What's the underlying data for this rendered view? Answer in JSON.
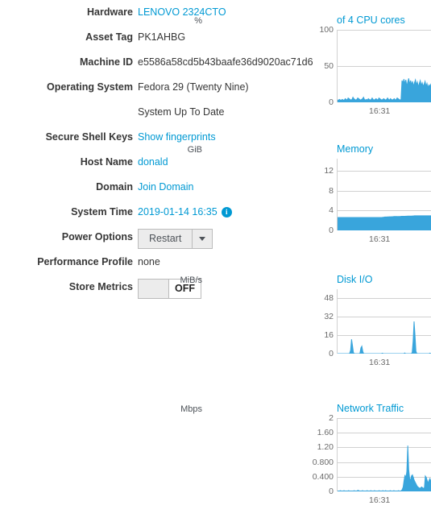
{
  "system_info": {
    "rows": [
      {
        "label": "Hardware",
        "value": "LENOVO 2324CTO",
        "type": "link"
      },
      {
        "label": "Asset Tag",
        "value": "PK1AHBG",
        "type": "text"
      },
      {
        "label": "Machine ID",
        "value": "e5586a58cd5b43baafe36d9020ac71d6",
        "type": "text"
      },
      {
        "label": "Operating System",
        "value": "Fedora 29 (Twenty Nine)",
        "type": "text"
      },
      {
        "label": "",
        "value": "System Up To Date",
        "type": "text"
      },
      {
        "label": "Secure Shell Keys",
        "value": "Show fingerprints",
        "type": "link"
      },
      {
        "label": "Host Name",
        "value": "donald",
        "type": "link"
      },
      {
        "label": "Domain",
        "value": "Join Domain",
        "type": "link"
      },
      {
        "label": "System Time",
        "value": "2019-01-14 16:35",
        "type": "link-info"
      },
      {
        "label": "Power Options",
        "value": "Restart",
        "type": "button-dropdown"
      },
      {
        "label": "Performance Profile",
        "value": "none",
        "type": "text"
      },
      {
        "label": "Store Metrics",
        "value": "OFF",
        "type": "toggle"
      }
    ],
    "info_icon_glyph": "i",
    "link_color": "#0099d3"
  },
  "chart_data": [
    {
      "type": "area",
      "title": "of 4 CPU cores",
      "unit": "%",
      "ylabel": "%",
      "xlabel": "",
      "ylim": [
        0,
        100
      ],
      "yticks": [
        100,
        50,
        0
      ],
      "ytick_labels": [
        "100",
        "50",
        "0"
      ],
      "xticks": [
        "16:31"
      ],
      "grid": true,
      "series_color": "#39a5dc",
      "values": [
        3,
        3,
        4,
        3,
        3,
        4,
        3,
        3,
        5,
        4,
        3,
        6,
        5,
        4,
        3,
        4,
        7,
        5,
        4,
        3,
        4,
        6,
        5,
        4,
        3,
        4,
        5,
        7,
        4,
        3,
        4,
        3,
        5,
        4,
        3,
        4,
        6,
        4,
        3,
        4,
        5,
        4,
        3,
        6,
        5,
        4,
        3,
        4,
        5,
        4,
        3,
        4,
        6,
        4,
        3,
        5,
        4,
        3,
        4,
        5,
        3,
        4,
        6,
        5,
        4,
        3,
        4,
        30,
        27,
        32,
        26,
        31,
        22,
        28,
        33,
        25,
        30,
        24,
        29,
        22,
        27,
        31,
        24,
        28,
        21,
        26,
        30,
        23,
        27,
        22,
        25,
        29,
        22,
        26,
        20,
        24,
        22,
        25,
        23
      ]
    },
    {
      "type": "area",
      "title": "Memory",
      "unit": "GiB",
      "ylabel": "GiB",
      "xlabel": "",
      "ylim": [
        0,
        14.5
      ],
      "yticks": [
        12,
        8,
        4,
        0
      ],
      "ytick_labels": [
        "12",
        "8",
        "4",
        "0"
      ],
      "xticks": [
        "16:31"
      ],
      "grid": true,
      "series_color": "#39a5dc",
      "values": [
        2.6,
        2.6,
        2.6,
        2.6,
        2.6,
        2.6,
        2.6,
        2.6,
        2.6,
        2.6,
        2.6,
        2.6,
        2.6,
        2.6,
        2.6,
        2.6,
        2.6,
        2.6,
        2.6,
        2.6,
        2.6,
        2.6,
        2.6,
        2.6,
        2.6,
        2.6,
        2.6,
        2.6,
        2.6,
        2.6,
        2.6,
        2.6,
        2.6,
        2.6,
        2.6,
        2.6,
        2.6,
        2.6,
        2.6,
        2.6,
        2.6,
        2.6,
        2.6,
        2.6,
        2.6,
        2.6,
        2.6,
        2.6,
        2.6,
        2.65,
        2.65,
        2.7,
        2.7,
        2.7,
        2.72,
        2.72,
        2.75,
        2.75,
        2.75,
        2.78,
        2.78,
        2.8,
        2.8,
        2.8,
        2.8,
        2.8,
        2.82,
        2.82,
        2.82,
        2.85,
        2.85,
        2.85,
        2.85,
        2.85,
        2.88,
        2.88,
        2.9,
        2.9,
        2.9,
        2.9,
        2.9,
        2.92,
        2.92,
        2.95,
        2.95,
        2.95,
        2.95,
        2.95,
        2.95,
        2.95,
        2.95,
        2.95,
        2.95,
        2.95,
        2.95,
        2.95,
        2.95,
        2.95,
        2.95,
        2.95,
        2.95,
        2.95,
        2.95
      ]
    },
    {
      "type": "area",
      "title": "Disk I/O",
      "unit": "MiB/s",
      "ylabel": "MiB/s",
      "xlabel": "",
      "ylim": [
        0,
        56
      ],
      "yticks": [
        48,
        32,
        16,
        0
      ],
      "ytick_labels": [
        "48",
        "32",
        "16",
        "0"
      ],
      "xticks": [
        "16:31"
      ],
      "grid": true,
      "series_color": "#39a5dc",
      "values": [
        0,
        0,
        0,
        0,
        0,
        0,
        0,
        0,
        0,
        0,
        0,
        0,
        0,
        0.3,
        3,
        12.5,
        7,
        1,
        0,
        0,
        0,
        0,
        0,
        0,
        0.4,
        5,
        6.5,
        2,
        0,
        0,
        0,
        0,
        0,
        0,
        0,
        0,
        0,
        0,
        0,
        0,
        0,
        0,
        0,
        0,
        0,
        0,
        0,
        0,
        0.4,
        0,
        0,
        0,
        0,
        0,
        0,
        0,
        0,
        0,
        0,
        0,
        0,
        0,
        0,
        0,
        0,
        0,
        0,
        0,
        0,
        0,
        0,
        0,
        0.6,
        0,
        0,
        0,
        0,
        0,
        0,
        0,
        1,
        11,
        28,
        16,
        2,
        0,
        0,
        0,
        0,
        0,
        0,
        0,
        0,
        0,
        0,
        0,
        0,
        0,
        0,
        0.5,
        0,
        0
      ]
    },
    {
      "type": "area",
      "title": "Network Traffic",
      "unit": "Mbps",
      "ylabel": "Mbps",
      "xlabel": "",
      "ylim": [
        0,
        2
      ],
      "yticks": [
        2,
        1.6,
        1.2,
        0.8,
        0.4,
        0
      ],
      "ytick_labels": [
        "2",
        "1.60",
        "1.20",
        "0.800",
        "0.400",
        "0"
      ],
      "xticks": [
        "16:31"
      ],
      "grid": true,
      "series_color": "#39a5dc",
      "values": [
        0.01,
        0.01,
        0.01,
        0.02,
        0.01,
        0.01,
        0.01,
        0.02,
        0.01,
        0.01,
        0.01,
        0.01,
        0.02,
        0.01,
        0.01,
        0.01,
        0.01,
        0.01,
        0.02,
        0.01,
        0.01,
        0.01,
        0.03,
        0.02,
        0.01,
        0.01,
        0.01,
        0.02,
        0.01,
        0.01,
        0.01,
        0.01,
        0.02,
        0.01,
        0.01,
        0.01,
        0.02,
        0.01,
        0.01,
        0.01,
        0.02,
        0.01,
        0.01,
        0.01,
        0.01,
        0.02,
        0.01,
        0.01,
        0.01,
        0.02,
        0.01,
        0.01,
        0.02,
        0.01,
        0.01,
        0.01,
        0.01,
        0.02,
        0.01,
        0.01,
        0.01,
        0.02,
        0.01,
        0.01,
        0.01,
        0.01,
        0.02,
        0.01,
        0.01,
        0.02,
        0.05,
        0.12,
        0.3,
        0.45,
        0.35,
        0.55,
        1.25,
        0.6,
        0.35,
        0.3,
        0.42,
        0.45,
        0.38,
        0.3,
        0.25,
        0.2,
        0.15,
        0.12,
        0.1,
        0.08,
        0.1,
        0.12,
        0.1,
        0.08,
        0.1,
        0.42,
        0.38,
        0.3,
        0.22,
        0.3,
        0.35,
        0.28,
        0.2
      ]
    }
  ]
}
